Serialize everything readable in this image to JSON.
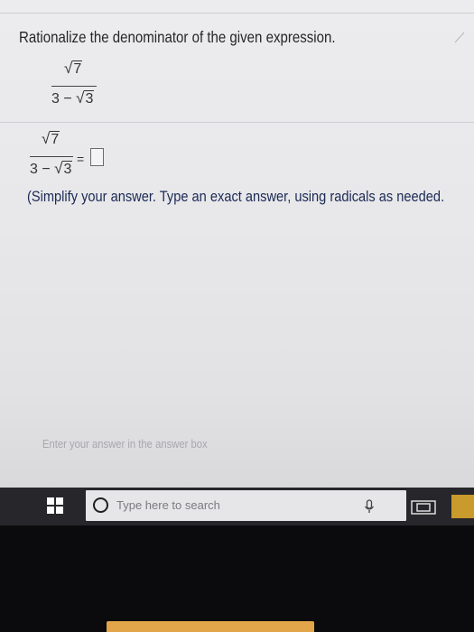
{
  "question": {
    "prompt": "Rationalize the denominator of the given expression.",
    "expression": {
      "numerator_radicand": "7",
      "denominator_prefix": "3 − ",
      "denominator_radicand": "3"
    }
  },
  "answer": {
    "equals": "=",
    "instruction": "(Simplify your answer. Type an exact answer, using radicals as needed."
  },
  "footer": {
    "hint": "Enter your answer in the answer box"
  },
  "taskbar": {
    "search_placeholder": "Type here to search",
    "icons": [
      "windows-start-icon",
      "cortana-icon",
      "microphone-icon",
      "task-view-icon",
      "file-explorer-icon"
    ]
  }
}
